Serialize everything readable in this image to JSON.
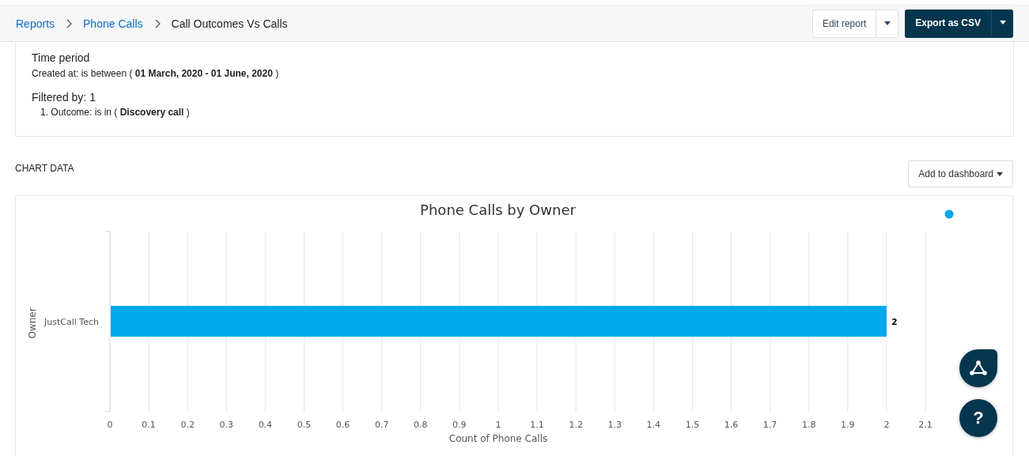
{
  "breadcrumbs": [
    {
      "label": "Reports",
      "kind": "link"
    },
    {
      "label": "Phone Calls",
      "kind": "link"
    },
    {
      "label": "Call Outcomes Vs Calls",
      "kind": "current"
    }
  ],
  "actions": {
    "edit": "Edit report",
    "export": "Export as CSV"
  },
  "summary": {
    "time_heading": "Time period",
    "time_text": "Created at: is between ( **01 March, 2020 - 01 June, 2020** )",
    "filter_heading": "Filtered by: 1",
    "filters": [
      "1. Outcome: is in ( **Discovery call** )"
    ]
  },
  "chart_section": {
    "heading": "CHART DATA",
    "add_button": "Add to dashboard",
    "chart_data": {
      "type": "bar",
      "orientation": "horizontal",
      "title": "Phone Calls by Owner",
      "xlabel": "Count of Phone Calls",
      "ylabel": "Owner",
      "categories": [
        "JustCall Tech"
      ],
      "series": [
        {
          "color": "#00a8ec",
          "values": [
            2
          ]
        }
      ],
      "grid": true,
      "xlim": [
        0,
        2.1
      ],
      "xticks": [
        0,
        0.1,
        0.2,
        0.3,
        0.4,
        0.5,
        0.6,
        0.7,
        0.8,
        0.9,
        1,
        1.1,
        1.2,
        1.3,
        1.4,
        1.5,
        1.6,
        1.7,
        1.8,
        1.9,
        2,
        2.1
      ],
      "data_labels": true
    }
  },
  "help_button": "?"
}
